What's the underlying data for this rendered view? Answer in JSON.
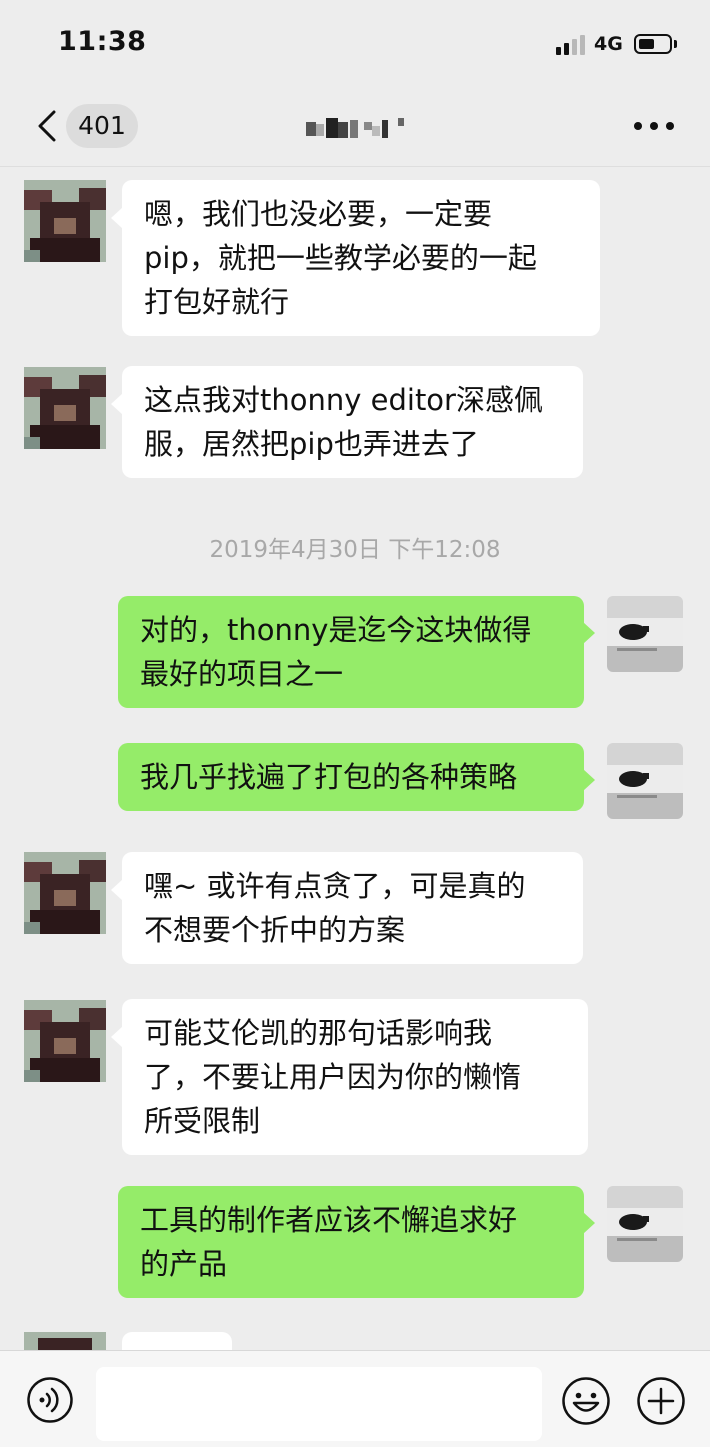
{
  "status_bar": {
    "time": "11:38",
    "network": "4G"
  },
  "nav": {
    "unread_count": "401",
    "title_redacted": true
  },
  "messages": [
    {
      "side": "in",
      "text": "嗯，我们也没必要，一定要\npip，就把一些教学必要的一起\n打包好就行"
    },
    {
      "side": "in",
      "text": "这点我对thonny editor深感佩\n服，居然把pip也弄进去了"
    },
    {
      "timestamp": "2019年4月30日 下午12:08"
    },
    {
      "side": "out",
      "text": "对的，thonny是迄今这块做得\n最好的项目之一"
    },
    {
      "side": "out",
      "text": "我几乎找遍了打包的各种策略"
    },
    {
      "side": "in",
      "text": "嘿~ 或许有点贪了，可是真的\n不想要个折中的方案"
    },
    {
      "side": "in",
      "text": "可能艾伦凯的那句话影响我\n了，不要让用户因为你的懒惰\n所受限制"
    },
    {
      "side": "out",
      "text": "工具的制作者应该不懈追求好\n的产品"
    }
  ],
  "input_bar": {
    "placeholder": ""
  },
  "icons": {
    "back": "chevron-left-icon",
    "more": "more-dots-icon",
    "voice": "voice-icon",
    "emoji": "emoji-icon",
    "plus": "plus-icon"
  },
  "colors": {
    "background": "#ededed",
    "outgoing_bubble": "#95ec69",
    "incoming_bubble": "#ffffff",
    "timestamp_text": "#a8a8a8"
  }
}
